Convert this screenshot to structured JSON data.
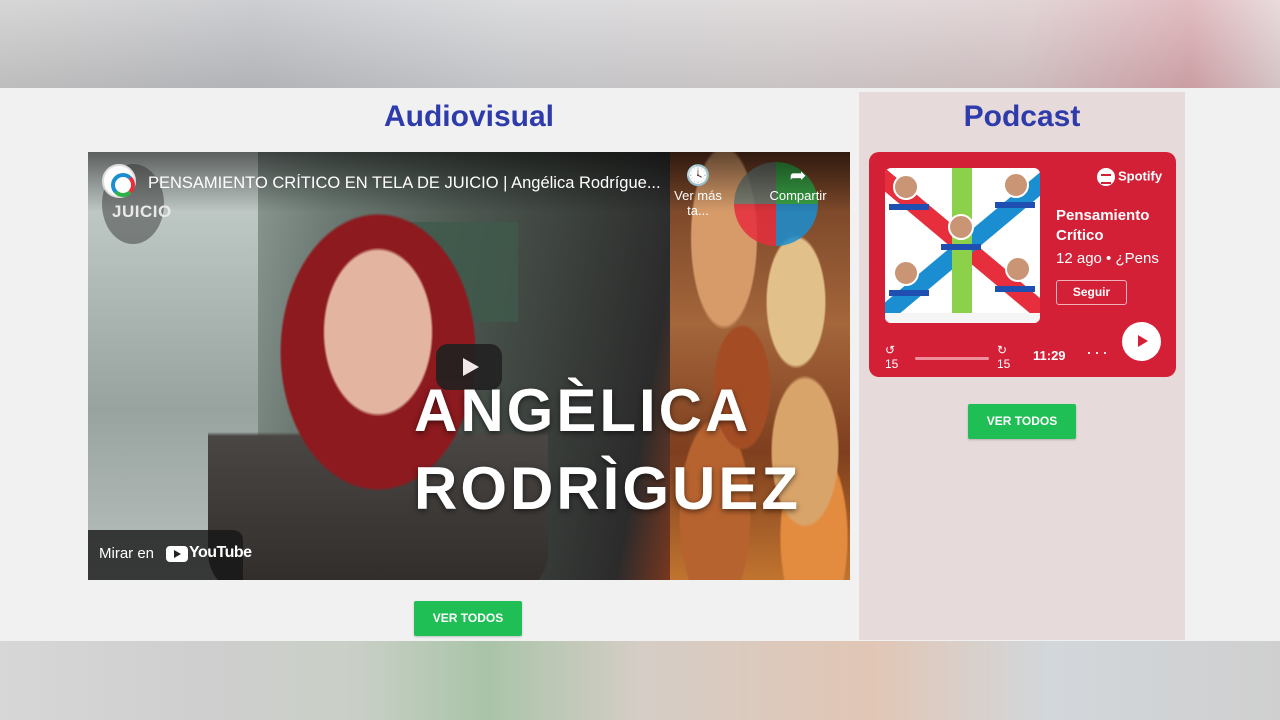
{
  "audiovisual": {
    "title": "Audiovisual",
    "video": {
      "channel_logo_text": "JUICIO",
      "title": "PENSAMIENTO CRÍTICO EN TELA DE JUICIO | Angélica Rodrígue...",
      "watch_later_label": "Ver más ta...",
      "share_label": "Compartir",
      "overlay_line1": "ANGÈLICA",
      "overlay_line2": "RODRÌGUEZ",
      "watch_on_label": "Mirar en",
      "youtube_label": "YouTube"
    },
    "button_label": "VER TODOS"
  },
  "podcast": {
    "title": "Podcast",
    "player": {
      "brand": "Spotify",
      "show_name": "Pensamiento Crítico",
      "episode_meta": "12 ago • ¿Pens",
      "follow_label": "Seguir",
      "rewind_label": "15",
      "forward_label": "15",
      "duration": "11:29",
      "more_label": "···"
    },
    "button_label": "VER TODOS"
  },
  "colors": {
    "title_blue": "#2e3bab",
    "button_green": "#1fbf55",
    "spotify_red": "#d42037",
    "podcast_panel": "#e7dadb"
  }
}
